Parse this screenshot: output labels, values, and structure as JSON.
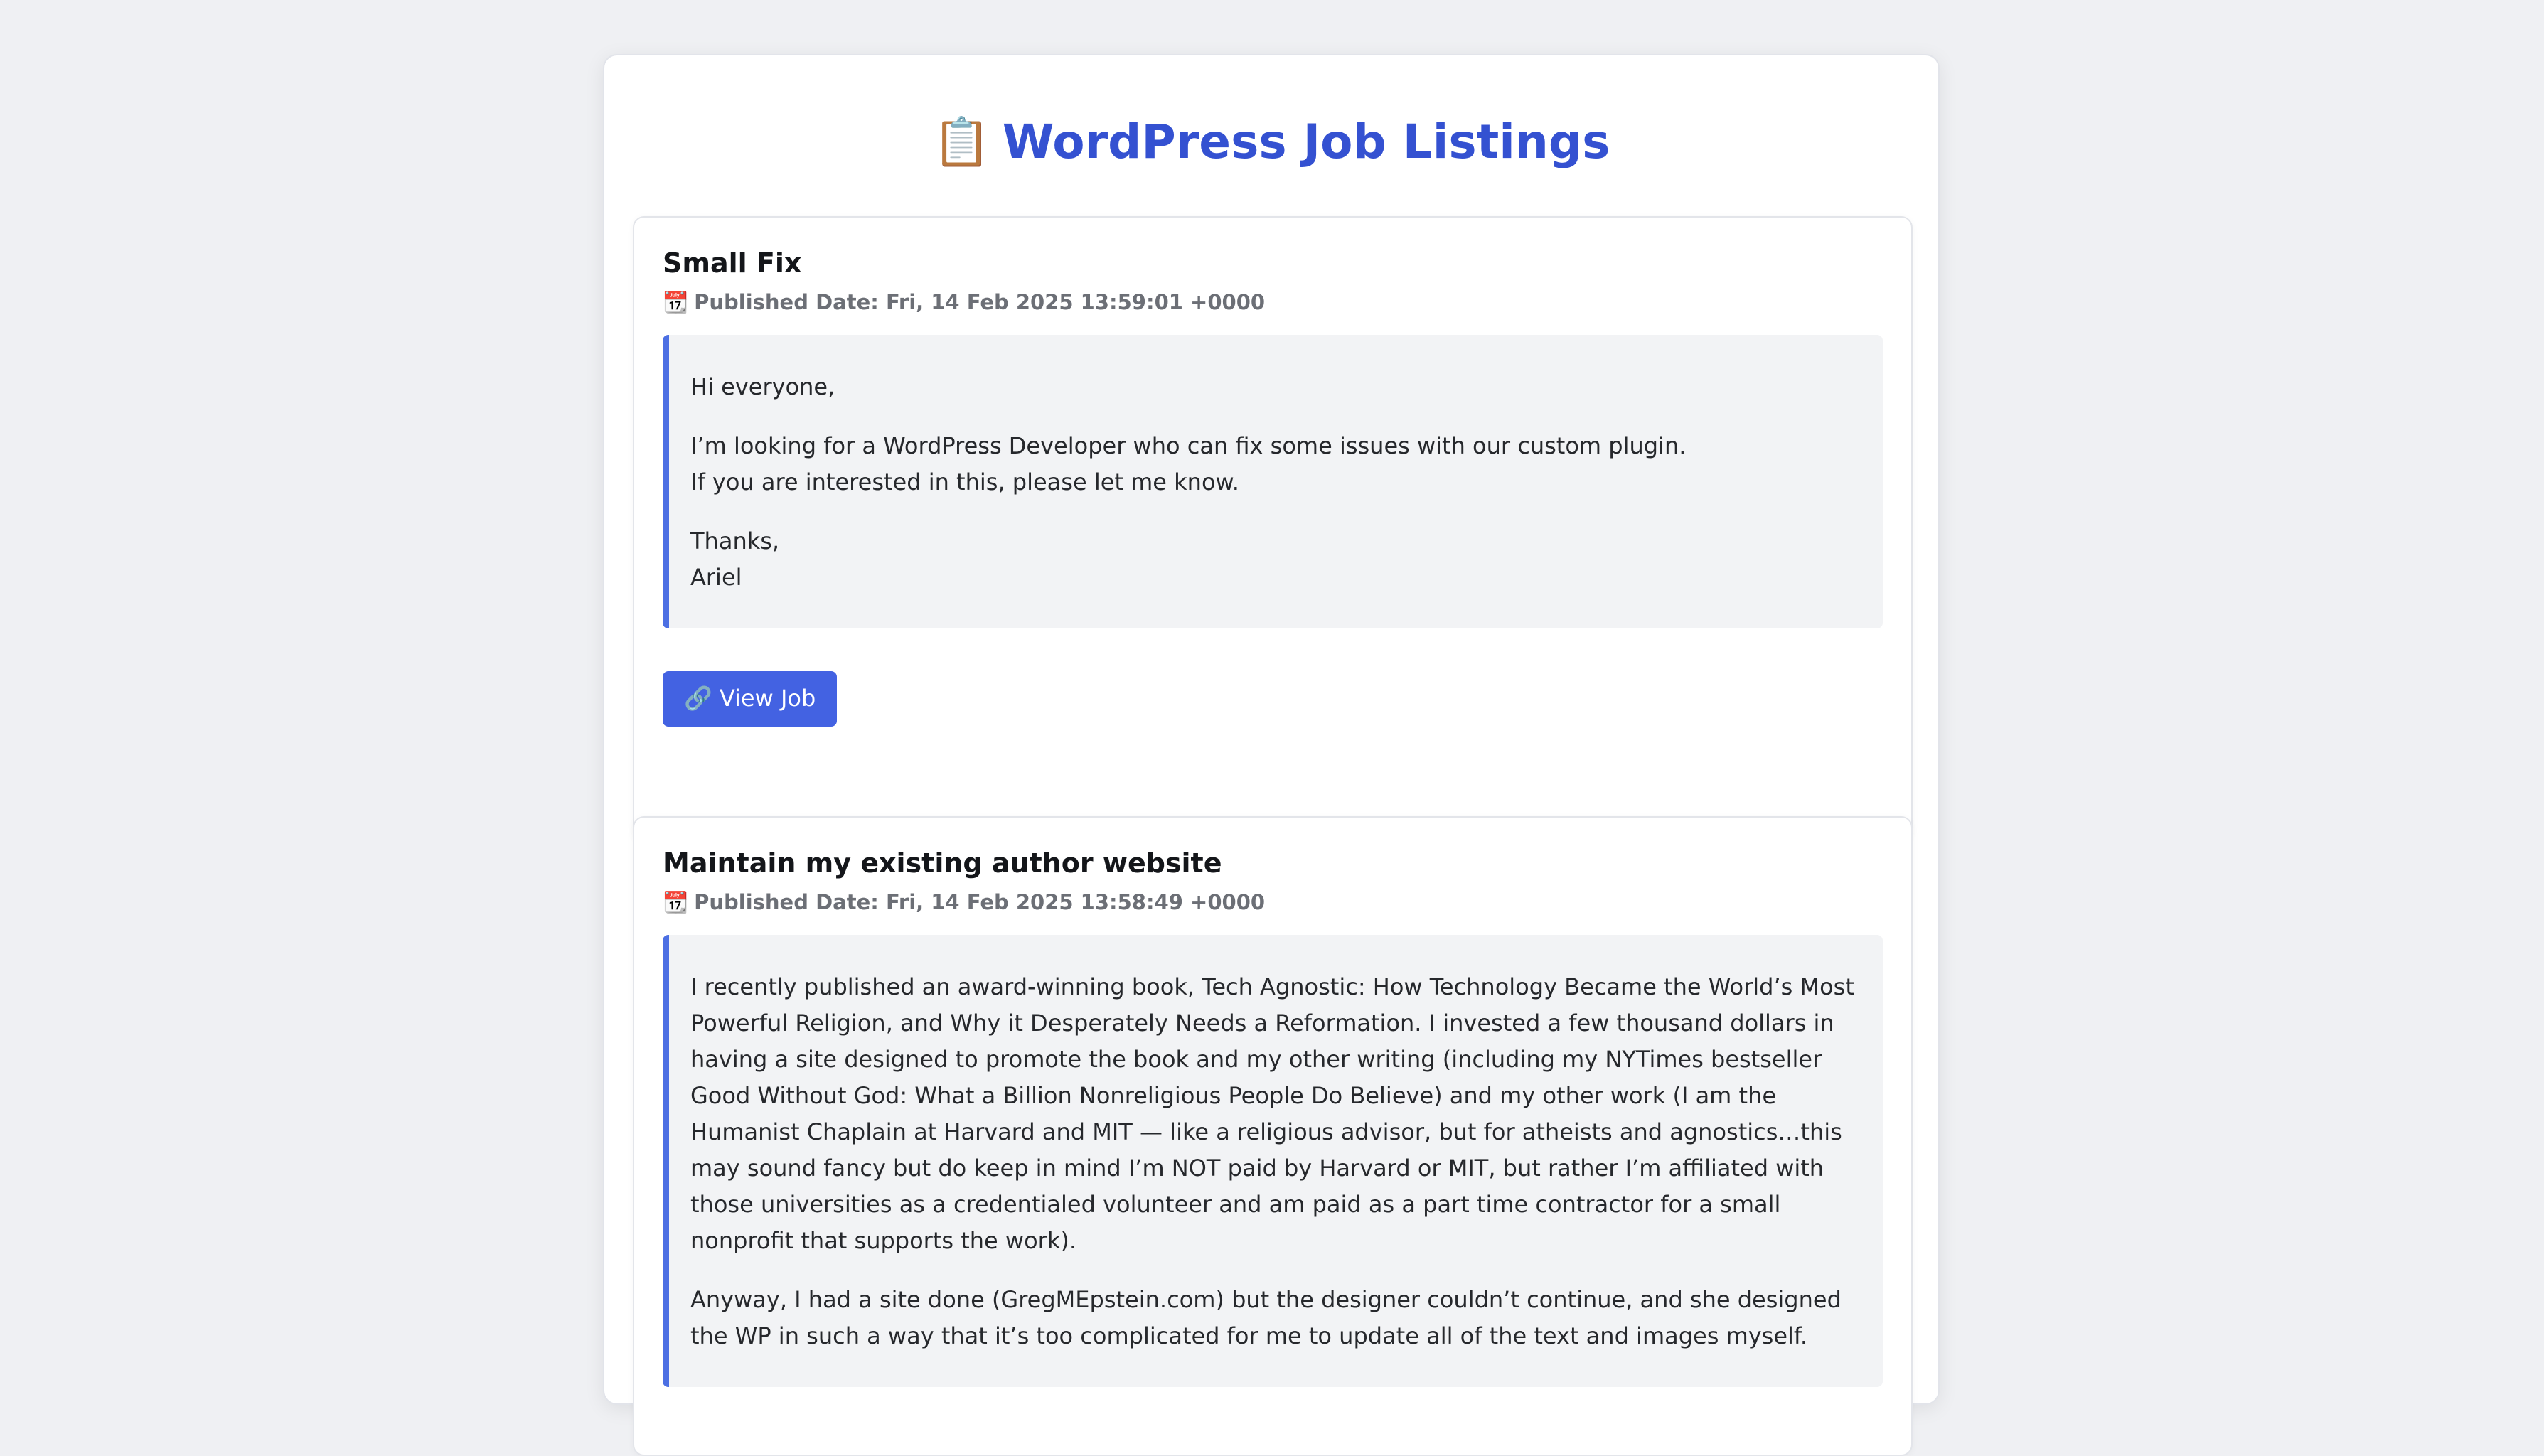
{
  "page": {
    "title": "WordPress Job Listings",
    "title_icon": "📋",
    "title_icon_name": "clipboard-icon",
    "accent_color": "#3451d1",
    "button_color": "#4362e2"
  },
  "jobs": [
    {
      "title": "Small Fix",
      "date_icon": "📆",
      "published": "Published Date: Fri, 14 Feb 2025 13:59:01 +0000",
      "paragraphs": [
        [
          "Hi everyone,"
        ],
        [
          "I’m looking for a WordPress Developer who can fix some issues with our custom plugin.",
          "If you are interested in this, please let me know."
        ],
        [
          "Thanks,",
          "Ariel"
        ]
      ],
      "button_icon": "🔗",
      "button_label": "View Job"
    },
    {
      "title": "Maintain my existing author website",
      "date_icon": "📆",
      "published": "Published Date: Fri, 14 Feb 2025 13:58:49 +0000",
      "paragraphs": [
        [
          "I recently published an award-winning book, Tech Agnostic: How Technology Became the World’s Most Powerful Religion, and Why it Desperately Needs a Reformation. I invested a few thousand dollars in having a site designed to promote the book and my other writing (including my NYTimes bestseller Good Without God: What a Billion Nonreligious People Do Believe) and my other work (I am the Humanist Chaplain at Harvard and MIT — like a religious advisor, but for atheists and agnostics…this may sound fancy but do keep in mind I’m NOT paid by Harvard or MIT, but rather I’m affiliated with those universities as a credentialed volunteer and am paid as a part time contractor for a small nonprofit that supports the work)."
        ],
        [
          "Anyway, I had a site done (GregMEpstein.com) but the designer couldn’t continue, and she designed the WP in such a way that it’s too complicated for me to update all of the text and images myself."
        ]
      ]
    }
  ]
}
